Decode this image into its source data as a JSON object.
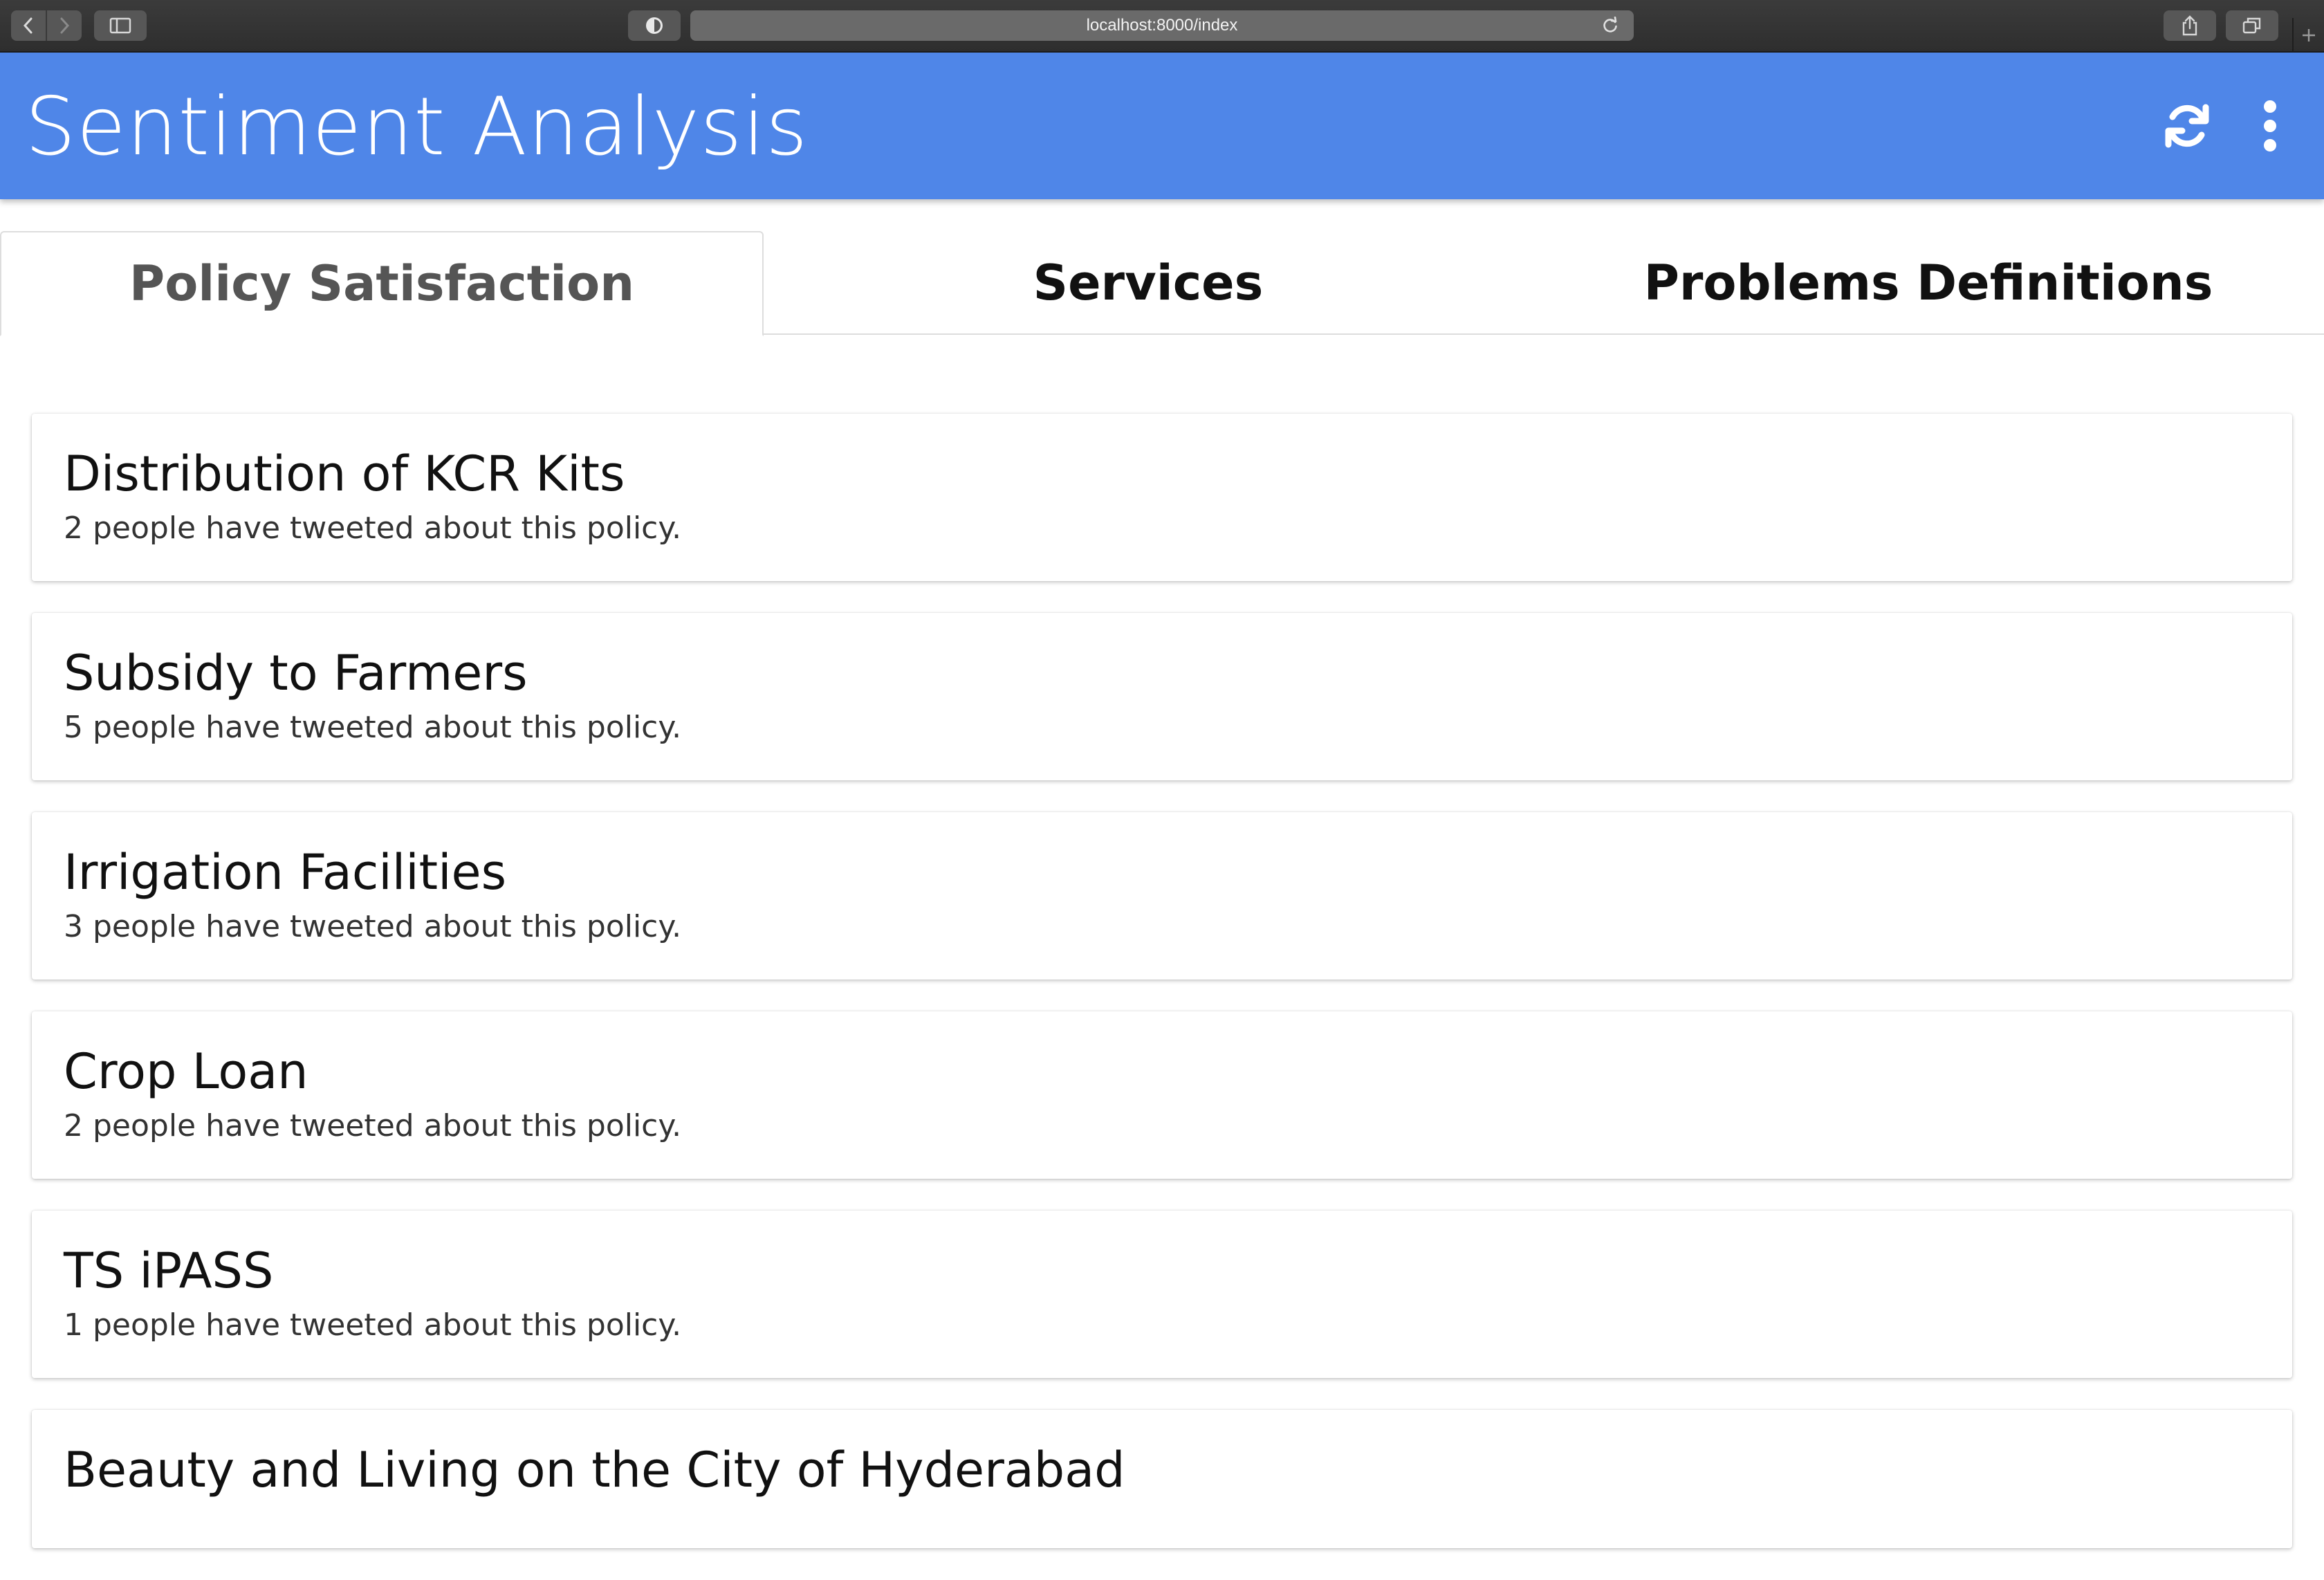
{
  "browser": {
    "url": "localhost:8000/index"
  },
  "app": {
    "title": "Sentiment Analysis"
  },
  "tabs": [
    {
      "label": "Policy Satisfaction",
      "active": true
    },
    {
      "label": "Services",
      "active": false
    },
    {
      "label": "Problems Definitions",
      "active": false
    }
  ],
  "policies": [
    {
      "name": "Distribution of KCR Kits",
      "summary": "2 people have tweeted about this policy."
    },
    {
      "name": "Subsidy to Farmers",
      "summary": "5 people have tweeted about this policy."
    },
    {
      "name": "Irrigation Facilities",
      "summary": "3 people have tweeted about this policy."
    },
    {
      "name": "Crop Loan",
      "summary": "2 people have tweeted about this policy."
    },
    {
      "name": "TS iPASS",
      "summary": "1 people have tweeted about this policy."
    },
    {
      "name": "Beauty and Living on the City of Hyderabad",
      "summary": ""
    }
  ],
  "colors": {
    "appbar": "#4f86e8",
    "chrome": "#2e2e2e"
  },
  "icons": {
    "refresh": "refresh-icon",
    "more": "more-vert-icon"
  }
}
